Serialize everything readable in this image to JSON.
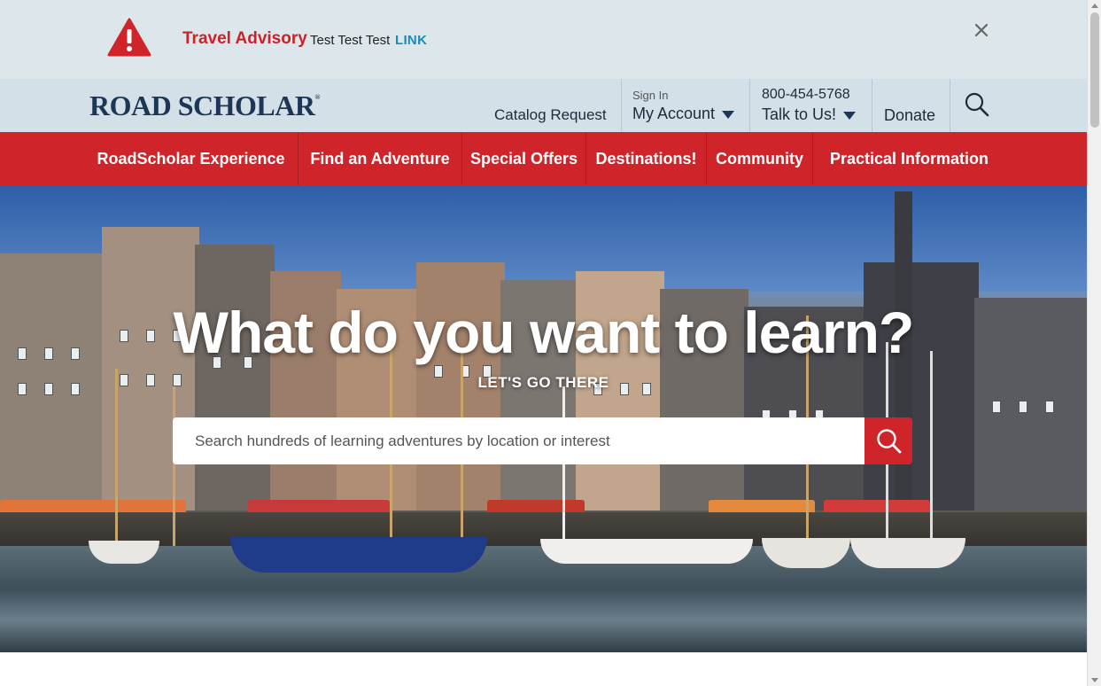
{
  "advisory": {
    "icon": "warning-triangle-icon",
    "title": "Travel Advisory",
    "message": "Test Test Test",
    "link_label": "LINK",
    "close_icon": "close-icon",
    "title_color": "#c8232a",
    "link_color": "#1a8ab8"
  },
  "header": {
    "logo_text": "ROAD SCHOLAR",
    "logo_mark": "®",
    "catalog_label": "Catalog Request",
    "account_small": "Sign In",
    "account_label": "My Account",
    "phone": "800-454-5768",
    "talk_label": "Talk to Us!",
    "donate_label": "Donate",
    "search_icon": "search-icon"
  },
  "nav": {
    "color": "#d0242b",
    "items": [
      {
        "label": "RoadScholar Experience"
      },
      {
        "label": "Find an Adventure"
      },
      {
        "label": "Special Offers"
      },
      {
        "label": "Destinations!"
      },
      {
        "label": "Community"
      },
      {
        "label": "Practical Information"
      }
    ]
  },
  "hero": {
    "title": "What do you want to learn?",
    "subtitle": "LET'S GO THERE",
    "search_placeholder": "Search hundreds of learning adventures by location or interest",
    "search_value": "",
    "search_button_icon": "search-icon"
  }
}
